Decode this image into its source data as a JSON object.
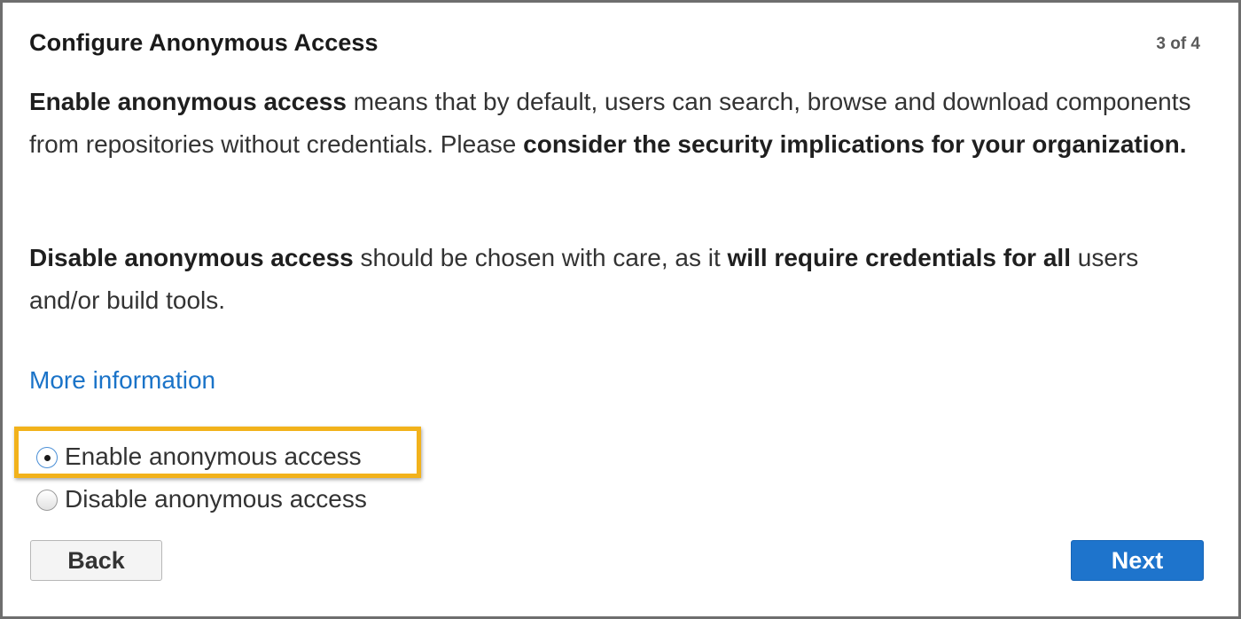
{
  "dialog": {
    "title": "Configure Anonymous Access",
    "step": "3 of 4"
  },
  "paragraph1": {
    "bold1": "Enable anonymous access",
    "text1": " means that by default, users can search, browse and download components from repositories without credentials. Please ",
    "bold2": "consider the security implications for your organization."
  },
  "paragraph2": {
    "bold1": "Disable anonymous access",
    "text1": " should be chosen with care, as it ",
    "bold2": "will require credentials for all",
    "text2": " users and/or build tools."
  },
  "more_info_link": "More information",
  "options": [
    {
      "label": "Enable anonymous access",
      "selected": true
    },
    {
      "label": "Disable anonymous access",
      "selected": false
    }
  ],
  "buttons": {
    "back": "Back",
    "next": "Next"
  },
  "colors": {
    "highlight": "#f2b21b",
    "link": "#1a73c8",
    "primary_button": "#1e74cc"
  }
}
